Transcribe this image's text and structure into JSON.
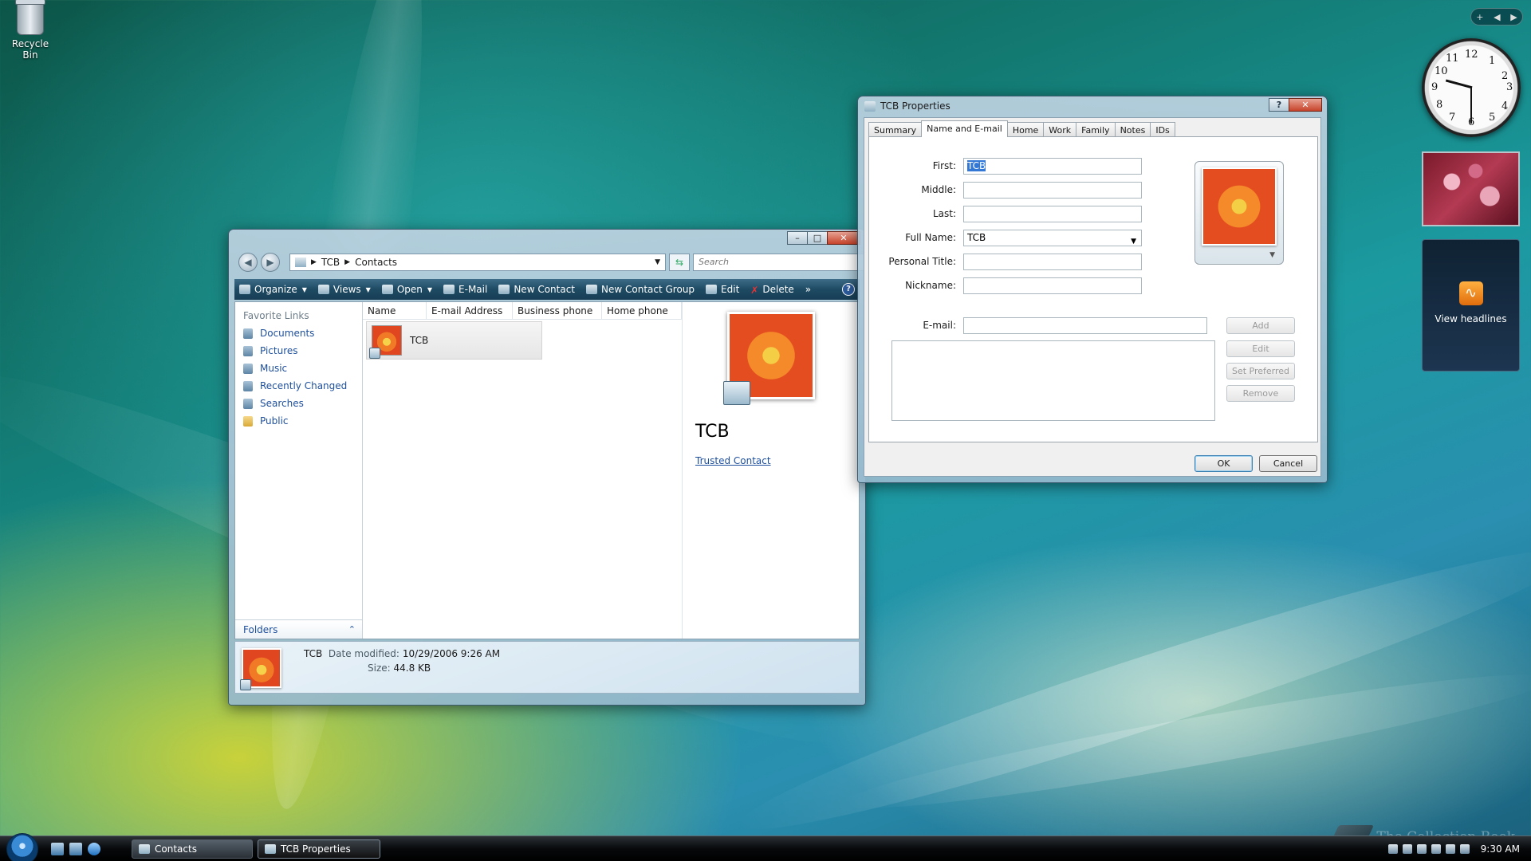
{
  "desktop": {
    "recycle_bin": "Recycle Bin"
  },
  "explorer": {
    "breadcrumb_root": "TCB",
    "breadcrumb_current": "Contacts",
    "search_placeholder": "Search",
    "toolbar": {
      "organize": "Organize",
      "views": "Views",
      "open": "Open",
      "email": "E-Mail",
      "new_contact": "New Contact",
      "new_contact_group": "New Contact Group",
      "edit": "Edit",
      "delete": "Delete",
      "more": "»",
      "help": "?"
    },
    "favorite_links_title": "Favorite Links",
    "favorite_links": [
      "Documents",
      "Pictures",
      "Music",
      "Recently Changed",
      "Searches",
      "Public"
    ],
    "folders_label": "Folders",
    "columns": [
      "Name",
      "E-mail Address",
      "Business phone",
      "Home phone"
    ],
    "items": [
      {
        "name": "TCB"
      }
    ],
    "preview": {
      "name": "TCB",
      "link": "Trusted Contact"
    },
    "details": {
      "name": "TCB",
      "date_label": "Date modified:",
      "date_value": "10/29/2006 9:26 AM",
      "size_label": "Size:",
      "size_value": "44.8 KB"
    }
  },
  "dialog": {
    "title": "TCB Properties",
    "tabs": [
      "Summary",
      "Name and E-mail",
      "Home",
      "Work",
      "Family",
      "Notes",
      "IDs"
    ],
    "active_tab": "Name and E-mail",
    "fields": {
      "first_label": "First:",
      "first_value": "TCB",
      "middle_label": "Middle:",
      "middle_value": "",
      "last_label": "Last:",
      "last_value": "",
      "fullname_label": "Full Name:",
      "fullname_value": "TCB",
      "title_label": "Personal Title:",
      "title_value": "",
      "nickname_label": "Nickname:",
      "nickname_value": "",
      "email_label": "E-mail:",
      "email_value": ""
    },
    "side_buttons": [
      "Add",
      "Edit",
      "Set Preferred",
      "Remove"
    ],
    "ok": "OK",
    "cancel": "Cancel"
  },
  "gadgets": {
    "sidebar_add": "+",
    "clock_numbers": [
      "12",
      "1",
      "2",
      "3",
      "4",
      "5",
      "6",
      "7",
      "8",
      "9",
      "10",
      "11"
    ],
    "feed_label": "View headlines"
  },
  "taskbar": {
    "tasks": [
      "Contacts",
      "TCB Properties"
    ],
    "time": "9:30 AM",
    "watermark": "The Collection Book"
  }
}
